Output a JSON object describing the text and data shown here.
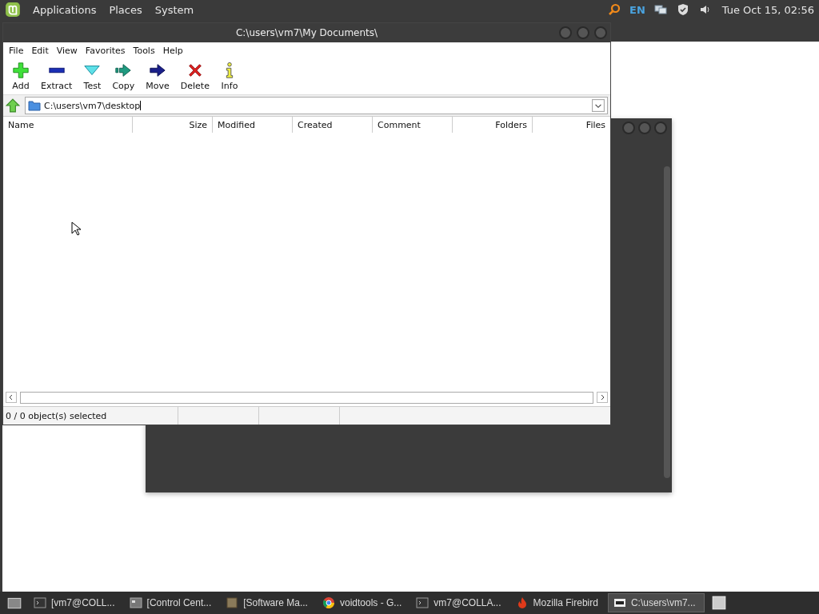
{
  "top_panel": {
    "menus": [
      "Applications",
      "Places",
      "System"
    ],
    "keyboard_layout": "EN",
    "clock": "Tue Oct 15, 02:56"
  },
  "window": {
    "title": "C:\\users\\vm7\\My Documents\\",
    "menu": [
      "File",
      "Edit",
      "View",
      "Favorites",
      "Tools",
      "Help"
    ],
    "toolbar": [
      {
        "label": "Add",
        "kind": "add"
      },
      {
        "label": "Extract",
        "kind": "extract"
      },
      {
        "label": "Test",
        "kind": "test"
      },
      {
        "label": "Copy",
        "kind": "copy"
      },
      {
        "label": "Move",
        "kind": "move"
      },
      {
        "label": "Delete",
        "kind": "delete"
      },
      {
        "label": "Info",
        "kind": "info"
      }
    ],
    "address": "C:\\users\\vm7\\desktop",
    "columns": [
      "Name",
      "Size",
      "Modified",
      "Created",
      "Comment",
      "Folders",
      "Files"
    ],
    "status": "0 / 0 object(s) selected"
  },
  "taskbar": [
    {
      "label": "[vm7@COLL...",
      "kind": "terminal",
      "selected": false
    },
    {
      "label": "[Control Cent...",
      "kind": "control",
      "selected": false
    },
    {
      "label": "[Software Ma...",
      "kind": "package",
      "selected": false
    },
    {
      "label": "voidtools - G...",
      "kind": "browser",
      "selected": false
    },
    {
      "label": "vm7@COLLA...",
      "kind": "terminal",
      "selected": false
    },
    {
      "label": "Mozilla Firebird",
      "kind": "fire",
      "selected": false
    },
    {
      "label": "C:\\users\\vm7...",
      "kind": "archiver",
      "selected": true
    }
  ]
}
